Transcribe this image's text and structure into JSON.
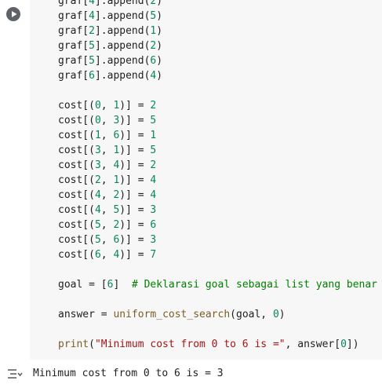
{
  "cell": {
    "lines": [
      "graf[4].append(2)",
      "graf[4].append(5)",
      "graf[2].append(1)",
      "graf[5].append(2)",
      "graf[5].append(6)",
      "graf[6].append(4)",
      "",
      "cost[(0, 1)] = 2",
      "cost[(0, 3)] = 5",
      "cost[(1, 6)] = 1",
      "cost[(3, 1)] = 5",
      "cost[(3, 4)] = 2",
      "cost[(2, 1)] = 4",
      "cost[(4, 2)] = 4",
      "cost[(4, 5)] = 3",
      "cost[(5, 2)] = 6",
      "cost[(5, 6)] = 3",
      "cost[(6, 4)] = 7",
      "",
      "goal = [6]  # Deklarasi goal sebagai list yang benar",
      "",
      "answer = uniform_cost_search(goal, 0)",
      "",
      "print(\"Minimum cost from 0 to 6 is =\", answer[0])"
    ]
  },
  "output": {
    "text": "Minimum cost from 0 to 6 is = 3"
  },
  "icons": {
    "run": "play-circle-icon",
    "output": "output-toggle-icon"
  },
  "colors": {
    "editor_bg": "#f7f7f7",
    "number": "#098658",
    "string": "#a31515",
    "comment": "#008000",
    "function": "#795e26"
  }
}
